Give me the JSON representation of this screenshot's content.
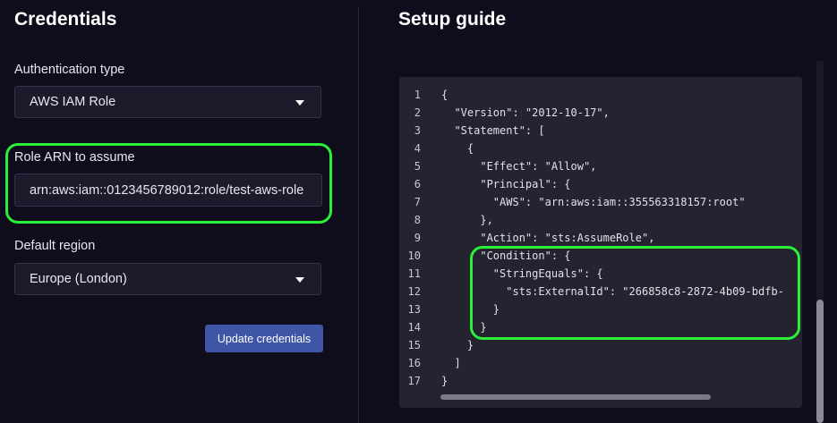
{
  "credentials": {
    "title": "Credentials",
    "auth_type_label": "Authentication type",
    "auth_type_value": "AWS IAM Role",
    "role_arn_label": "Role ARN to assume",
    "role_arn_value": "arn:aws:iam::0123456789012:role/test-aws-role",
    "region_label": "Default region",
    "region_value": "Europe (London)",
    "update_button": "Update credentials"
  },
  "setup_guide": {
    "title": "Setup guide",
    "code_lines": [
      {
        "no": "1",
        "text": "{"
      },
      {
        "no": "2",
        "text": "  \"Version\": \"2012-10-17\","
      },
      {
        "no": "3",
        "text": "  \"Statement\": ["
      },
      {
        "no": "4",
        "text": "    {"
      },
      {
        "no": "5",
        "text": "      \"Effect\": \"Allow\","
      },
      {
        "no": "6",
        "text": "      \"Principal\": {"
      },
      {
        "no": "7",
        "text": "        \"AWS\": \"arn:aws:iam::355563318157:root\""
      },
      {
        "no": "8",
        "text": "      },"
      },
      {
        "no": "9",
        "text": "      \"Action\": \"sts:AssumeRole\","
      },
      {
        "no": "10",
        "text": "      \"Condition\": {"
      },
      {
        "no": "11",
        "text": "        \"StringEquals\": {"
      },
      {
        "no": "12",
        "text": "          \"sts:ExternalId\": \"266858c8-2872-4b09-bdfb-"
      },
      {
        "no": "13",
        "text": "        }"
      },
      {
        "no": "14",
        "text": "      }"
      },
      {
        "no": "15",
        "text": "    }"
      },
      {
        "no": "16",
        "text": "  ]"
      },
      {
        "no": "17",
        "text": "}"
      }
    ]
  },
  "colors": {
    "background": "#0f0c1c",
    "highlight": "#2bf03a",
    "button": "#3f55a6",
    "code_bg": "#24232f"
  },
  "icons": {
    "dropdown": "chevron-down-icon"
  }
}
